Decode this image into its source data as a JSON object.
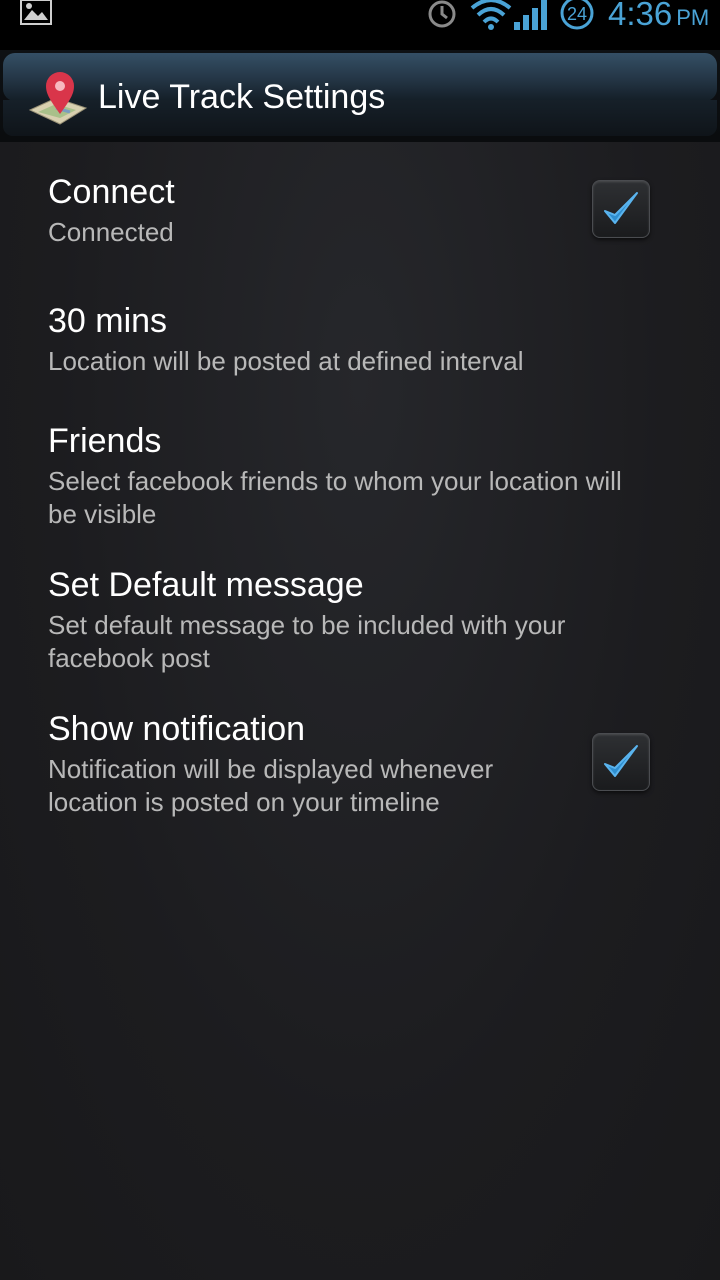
{
  "status_bar": {
    "time": "4:36",
    "ampm": "PM",
    "badge_number": "24",
    "accent_color": "#4aa3d6"
  },
  "app_bar": {
    "title": "Live Track Settings",
    "icon": "map-pin-icon"
  },
  "preferences": [
    {
      "title": "Connect",
      "summary": "Connected",
      "has_checkbox": true,
      "checked": true
    },
    {
      "title": "30 mins",
      "summary": "Location will be posted at defined interval",
      "has_checkbox": false
    },
    {
      "title": "Friends",
      "summary": "Select facebook friends to whom your location will be visible",
      "has_checkbox": false
    },
    {
      "title": "Set Default message",
      "summary": "Set default message to be included with your facebook post",
      "has_checkbox": false
    },
    {
      "title": "Show notification",
      "summary": "Notification will be displayed whenever location is posted on your timeline",
      "has_checkbox": true,
      "checked": true
    }
  ]
}
